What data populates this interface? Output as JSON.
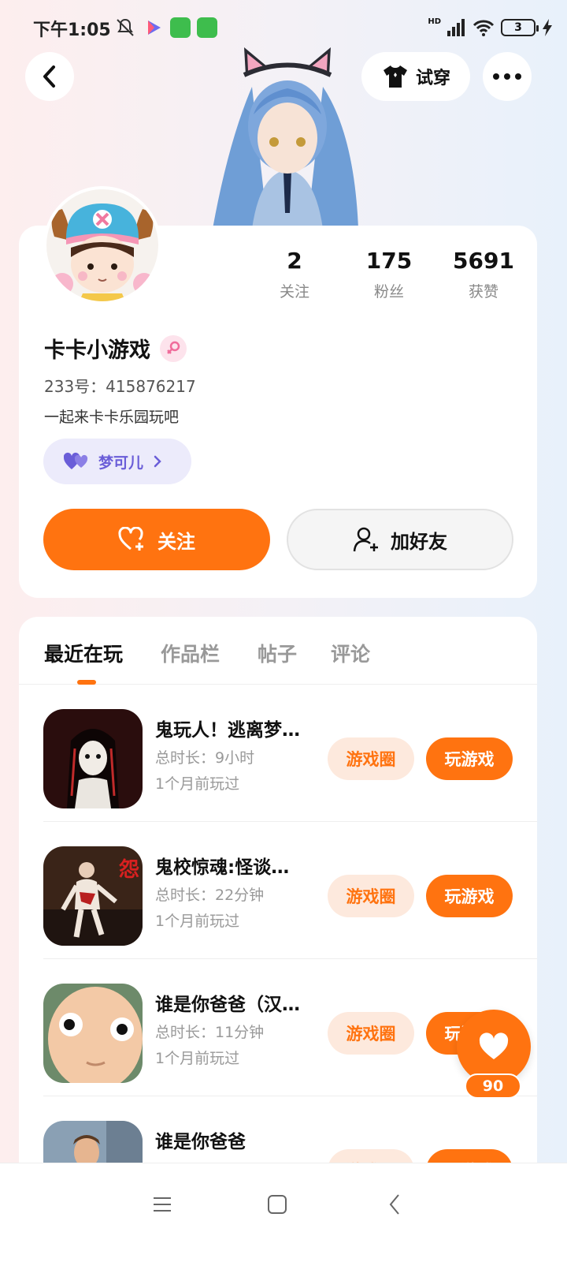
{
  "status_bar": {
    "time": "下午1:05",
    "signal_label": "HD",
    "battery": "3"
  },
  "header": {
    "tryon_label": "试穿"
  },
  "profile": {
    "stats": [
      {
        "value": "2",
        "label": "关注"
      },
      {
        "value": "175",
        "label": "粉丝"
      },
      {
        "value": "5691",
        "label": "获赞"
      }
    ],
    "nickname": "卡卡小游戏",
    "user_id": "233号：415876217",
    "bio": "一起来卡卡乐园玩吧",
    "club_label": "梦可儿",
    "follow_label": "关注",
    "add_friend_label": "加好友"
  },
  "tabs": [
    {
      "label": "最近在玩"
    },
    {
      "label": "作品栏"
    },
    {
      "label": "帖子"
    },
    {
      "label": "评论"
    }
  ],
  "games": [
    {
      "name": "鬼玩人！逃离梦…",
      "duration": "总时长：9小时",
      "last_played": "1个月前玩过",
      "circle_label": "游戏圈",
      "play_label": "玩游戏"
    },
    {
      "name": "鬼校惊魂:怪谈…",
      "duration": "总时长：22分钟",
      "last_played": "1个月前玩过",
      "circle_label": "游戏圈",
      "play_label": "玩游戏"
    },
    {
      "name": "谁是你爸爸（汉…",
      "duration": "总时长：11分钟",
      "last_played": "1个月前玩过",
      "circle_label": "游戏圈",
      "play_label": "玩游戏"
    },
    {
      "name": "谁是你爸爸",
      "duration": "",
      "last_played": "",
      "circle_label": "游戏圈",
      "play_label": "玩游戏"
    }
  ],
  "floating_like": {
    "count": "90"
  },
  "colors": {
    "accent": "#ff7310",
    "club": "#6a5dd8"
  }
}
